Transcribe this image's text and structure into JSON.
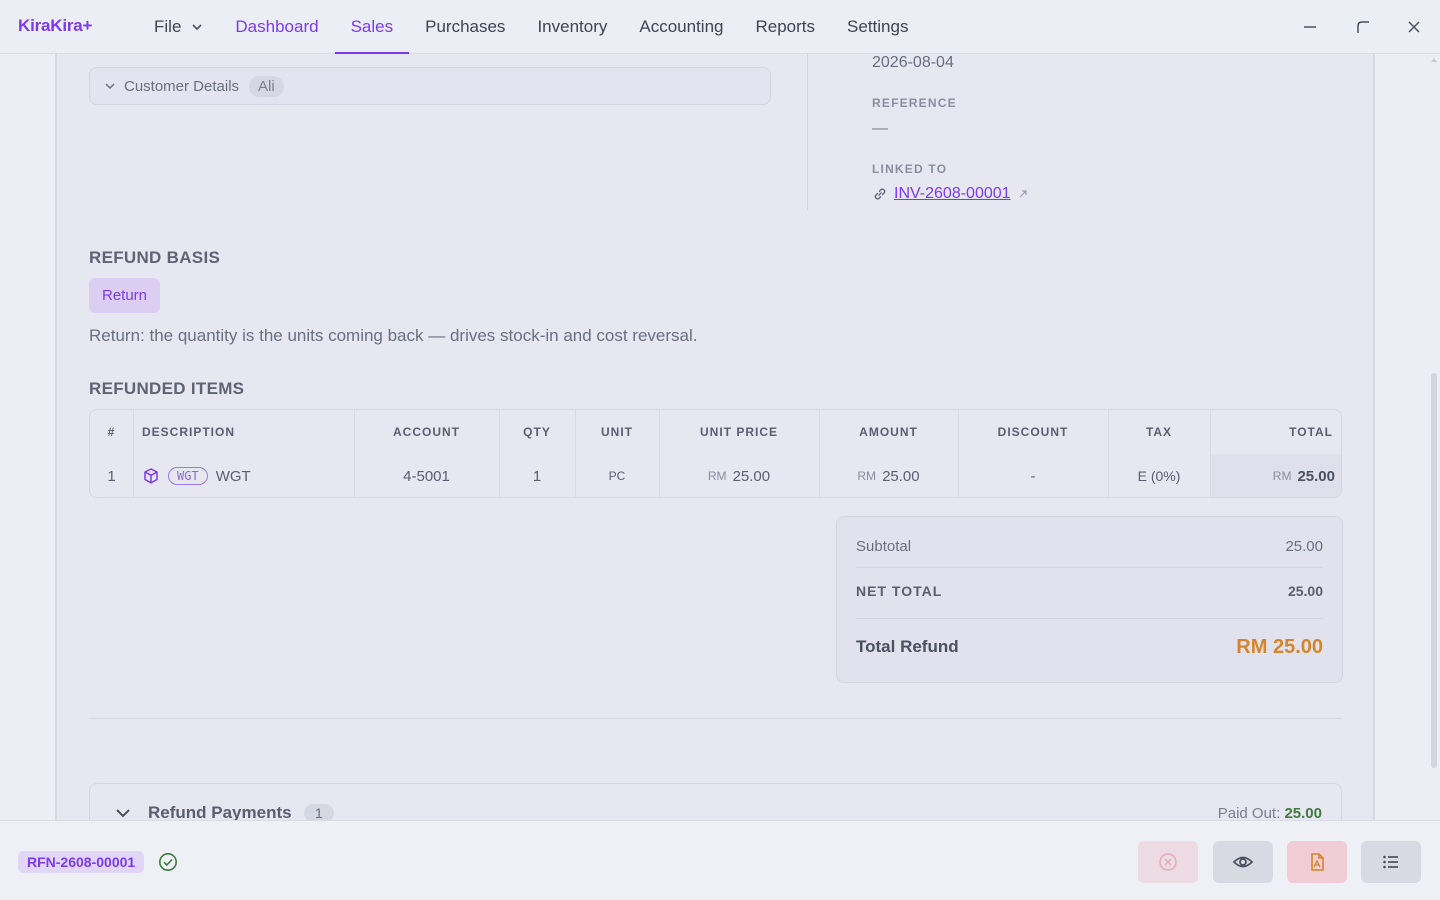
{
  "app": {
    "brand": "KiraKira+"
  },
  "menu": {
    "file": "File",
    "dashboard": "Dashboard",
    "sales": "Sales",
    "purchases": "Purchases",
    "inventory": "Inventory",
    "accounting": "Accounting",
    "reports": "Reports",
    "settings": "Settings"
  },
  "customer": {
    "section_label": "Customer Details",
    "name": "Ali"
  },
  "meta": {
    "date": "2026-08-04",
    "reference_label": "REFERENCE",
    "reference_value": "—",
    "linked_label": "LINKED TO",
    "linked_value": "INV-2608-00001"
  },
  "refund_basis": {
    "title": "REFUND BASIS",
    "option": "Return",
    "description": "Return: the quantity is the units coming back — drives stock-in and cost reversal."
  },
  "items": {
    "title": "REFUNDED ITEMS",
    "headers": {
      "no": "#",
      "description": "DESCRIPTION",
      "account": "ACCOUNT",
      "qty": "QTY",
      "unit": "UNIT",
      "unit_price": "UNIT PRICE",
      "amount": "AMOUNT",
      "discount": "DISCOUNT",
      "tax": "TAX",
      "total": "TOTAL"
    },
    "rows": [
      {
        "no": "1",
        "code": "WGT",
        "name": "WGT",
        "account": "4-5001",
        "qty": "1",
        "unit": "PC",
        "currency": "RM",
        "unit_price": "25.00",
        "amount": "25.00",
        "discount": "-",
        "tax": "E (0%)",
        "total": "25.00"
      }
    ]
  },
  "totals": {
    "subtotal_label": "Subtotal",
    "subtotal": "25.00",
    "net_label": "NET TOTAL",
    "net": "25.00",
    "refund_label": "Total Refund",
    "refund": "RM 25.00"
  },
  "payments": {
    "title": "Refund Payments",
    "count": "1",
    "paid_label": "Paid Out:",
    "paid_value": "25.00"
  },
  "footer": {
    "doc_id": "RFN-2608-00001"
  },
  "colors": {
    "accent": "#7c3aed",
    "refund": "#d4872a",
    "paid": "#3f7a3f"
  }
}
